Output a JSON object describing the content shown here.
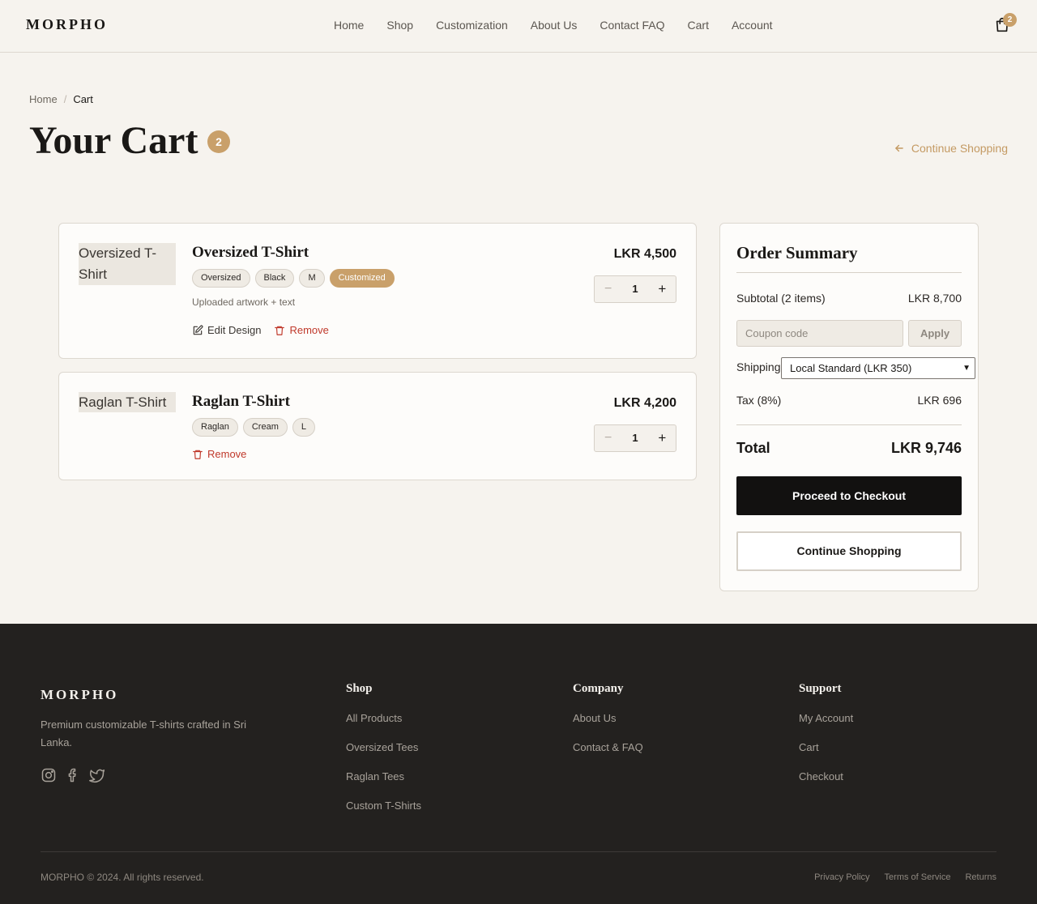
{
  "header": {
    "logo": "MORPHO",
    "nav": [
      "Home",
      "Shop",
      "Customization",
      "About Us",
      "Contact FAQ",
      "Cart",
      "Account"
    ],
    "cart_count": "2",
    "cart_icon": "shopping-bag-icon"
  },
  "breadcrumb": {
    "home": "Home",
    "separator": "/",
    "current": "Cart"
  },
  "page": {
    "title": "Your Cart",
    "count_badge": "2",
    "continue_link": "Continue Shopping"
  },
  "items": [
    {
      "image_alt": "Oversized T-Shirt",
      "name": "Oversized T-Shirt",
      "tags": [
        "Oversized",
        "Black",
        "M",
        "Customized"
      ],
      "note": "Uploaded artwork + text",
      "edit_label": "Edit Design",
      "remove_label": "Remove",
      "price": "LKR 4,500",
      "quantity": "1",
      "minus": "−",
      "plus": "+"
    },
    {
      "image_alt": "Raglan T-Shirt",
      "name": "Raglan T-Shirt",
      "tags": [
        "Raglan",
        "Cream",
        "L"
      ],
      "remove_label": "Remove",
      "price": "LKR 4,200",
      "quantity": "1",
      "minus": "−",
      "plus": "+"
    }
  ],
  "summary": {
    "title": "Order Summary",
    "subtotal_label": "Subtotal (2 items)",
    "subtotal_value": "LKR 8,700",
    "coupon_placeholder": "Coupon code",
    "apply_label": "Apply",
    "shipping_label": "Shipping",
    "shipping_selected": "Local Standard (LKR 350)",
    "tax_label": "Tax (8%)",
    "tax_value": "LKR 696",
    "total_label": "Total",
    "total_value": "LKR 9,746",
    "checkout_label": "Proceed to Checkout",
    "continue_label": "Continue Shopping"
  },
  "footer": {
    "logo": "MORPHO",
    "tagline": "Premium customizable T-shirts crafted in Sri Lanka.",
    "social_icons": [
      "instagram-icon",
      "facebook-icon",
      "twitter-icon"
    ],
    "columns": [
      {
        "title": "Shop",
        "links": [
          "All Products",
          "Oversized Tees",
          "Raglan Tees",
          "Custom T-Shirts"
        ]
      },
      {
        "title": "Company",
        "links": [
          "About Us",
          "Contact & FAQ"
        ]
      },
      {
        "title": "Support",
        "links": [
          "My Account",
          "Cart",
          "Checkout"
        ]
      }
    ],
    "copyright": "MORPHO © 2024. All rights reserved.",
    "legal": [
      "Privacy Policy",
      "Terms of Service",
      "Returns"
    ]
  },
  "colors": {
    "accent": "#c9a06a",
    "background": "#f6f3ee",
    "footer": "#23211f",
    "danger": "#c0392b",
    "primary_button": "#121110"
  }
}
